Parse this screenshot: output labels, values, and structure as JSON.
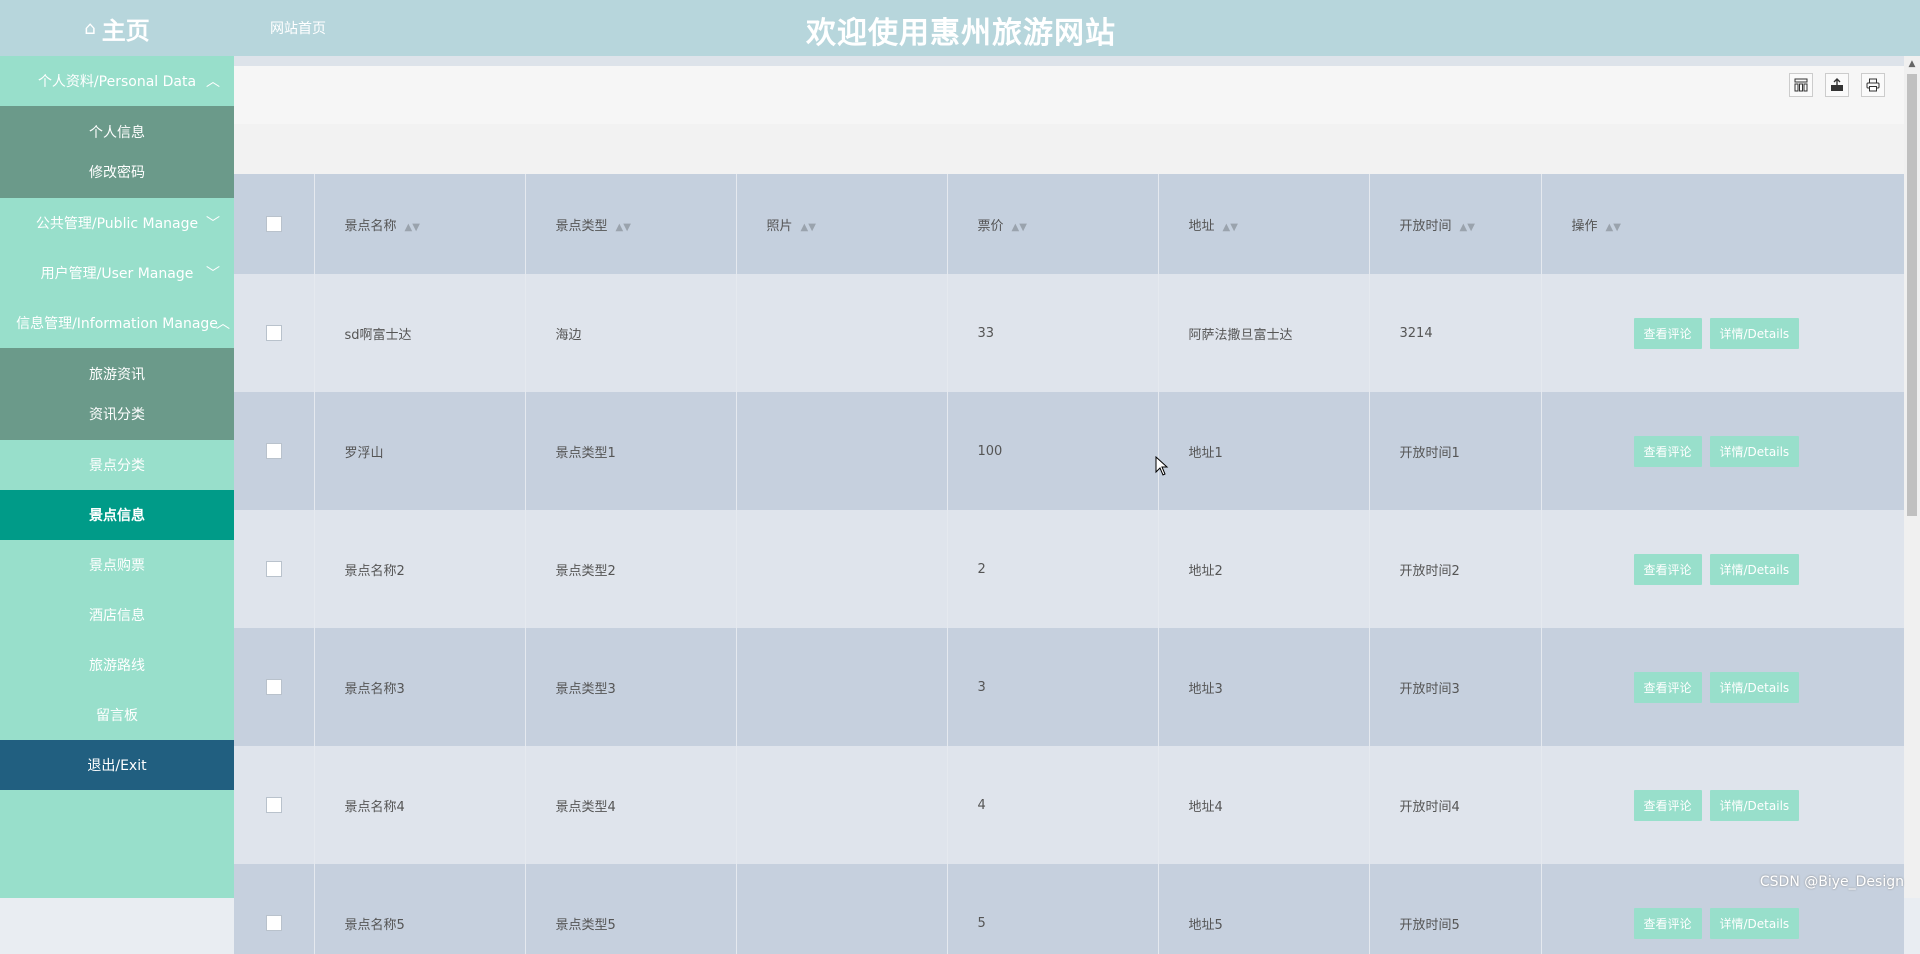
{
  "header": {
    "home_icon": "home-icon",
    "home_label": "主页",
    "breadcrumb": "网站首页",
    "site_title": "欢迎使用惠州旅游网站"
  },
  "sidebar": {
    "groups": [
      {
        "label": "个人资料/Personal Data",
        "expanded": true,
        "arrow": "chevron-up-icon",
        "items": [
          "个人信息",
          "修改密码"
        ]
      },
      {
        "label": "公共管理/Public Manage",
        "expanded": false,
        "arrow": "chevron-down-icon"
      },
      {
        "label": "用户管理/User Manage",
        "expanded": false,
        "arrow": "chevron-down-icon"
      },
      {
        "label": "信息管理/Information Manage",
        "expanded": true,
        "arrow": "chevron-up-icon",
        "items": [
          "旅游资讯",
          "资讯分类"
        ]
      }
    ],
    "items": [
      "景点分类",
      "景点信息",
      "景点购票",
      "酒店信息",
      "旅游路线",
      "留言板"
    ],
    "active_item": "景点信息",
    "exit_label": "退出/Exit"
  },
  "toolbar": {
    "icons": [
      "columns-icon",
      "export-icon",
      "print-icon"
    ]
  },
  "table": {
    "columns": [
      "景点名称",
      "景点类型",
      "照片",
      "票价",
      "地址",
      "开放时间",
      "操作"
    ],
    "rows": [
      {
        "name": "sd啊富士达",
        "type": "海边",
        "photo": "",
        "price": "33",
        "address": "阿萨法撒旦富士达",
        "open_time": "3214"
      },
      {
        "name": "罗浮山",
        "type": "景点类型1",
        "photo": "",
        "price": "100",
        "address": "地址1",
        "open_time": "开放时间1"
      },
      {
        "name": "景点名称2",
        "type": "景点类型2",
        "photo": "",
        "price": "2",
        "address": "地址2",
        "open_time": "开放时间2"
      },
      {
        "name": "景点名称3",
        "type": "景点类型3",
        "photo": "",
        "price": "3",
        "address": "地址3",
        "open_time": "开放时间3"
      },
      {
        "name": "景点名称4",
        "type": "景点类型4",
        "photo": "",
        "price": "4",
        "address": "地址4",
        "open_time": "开放时间4"
      },
      {
        "name": "景点名称5",
        "type": "景点类型5",
        "photo": "",
        "price": "5",
        "address": "地址5",
        "open_time": "开放时间5"
      }
    ],
    "actions": [
      "查看评论",
      "详情/Details"
    ]
  },
  "watermark": "CSDN @Biye_Design",
  "colors": {
    "header_bg": "#b7d6dc",
    "sidebar_bg": "#98dfcb",
    "submenu_bg": "#6b9a8a",
    "active_bg": "#009b88",
    "exit_bg": "#215f80",
    "button_bg": "#98dfcb"
  }
}
